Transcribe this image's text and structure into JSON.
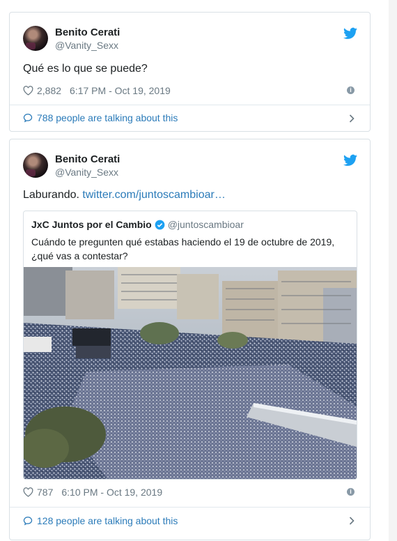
{
  "tweets": [
    {
      "author": {
        "name": "Benito Cerati",
        "handle": "@Vanity_Sexx"
      },
      "text": "Qué es lo que se puede?",
      "likes": "2,882",
      "timestamp": "6:17 PM - Oct 19, 2019",
      "talking": "788 people are talking about this"
    },
    {
      "author": {
        "name": "Benito Cerati",
        "handle": "@Vanity_Sexx"
      },
      "text": "Laburando.",
      "link": "twitter.com/juntoscambioar…",
      "quoted": {
        "name": "JxC Juntos por el Cambio",
        "handle": "@juntoscambioar",
        "text": "Cuándo te pregunten qué estabas haciendo el 19 de octubre de 2019, ¿qué vas a contestar?"
      },
      "likes": "787",
      "timestamp": "6:10 PM - Oct 19, 2019",
      "talking": "128 people are talking about this"
    }
  ],
  "colors": {
    "link": "#2b7bb9",
    "twitter_blue": "#1da1f2",
    "muted": "#697882",
    "border": "#d9e0e5"
  },
  "icons": [
    "twitter-bird-icon",
    "heart-icon",
    "info-icon",
    "comment-bubble-icon",
    "chevron-right-icon",
    "verified-badge-icon"
  ]
}
